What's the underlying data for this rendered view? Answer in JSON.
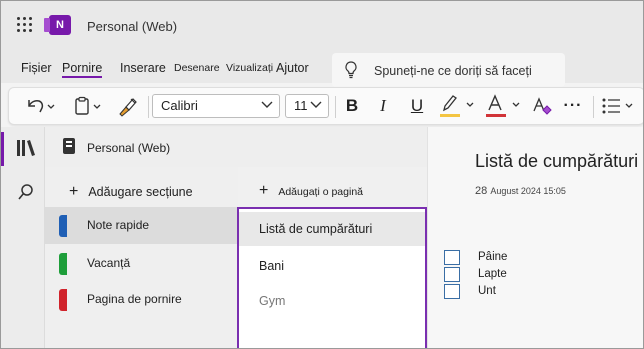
{
  "app": {
    "notebook_title": "Personal (Web)",
    "logo_letter": "N"
  },
  "menu": {
    "tabs": [
      "Fișier",
      "Pornire",
      "Inserare",
      "Desenare",
      "Vizualizați",
      "Ajutor"
    ],
    "active_tab": "Pornire",
    "tell_me": "Spuneți-ne ce doriți să faceți"
  },
  "ribbon": {
    "font_name": "Calibri",
    "font_size": "11",
    "bold": "B",
    "italic": "I",
    "underline": "U",
    "font_color_letter": "A",
    "highlight_color": "#f4c542",
    "font_color": "#d13438",
    "more": "···"
  },
  "notebook": {
    "header": "Personal (Web)",
    "add_section": "Adăugare secțiune",
    "add_page": "Adăugați o pagină",
    "sections": [
      {
        "label": "Note rapide",
        "color": "#1f5fb5"
      },
      {
        "label": "Vacanță",
        "color": "#1e9e3a"
      },
      {
        "label": "Pagina de pornire",
        "color": "#d0232b"
      }
    ],
    "selected_section": "Note rapide",
    "pages": [
      "Listă de cumpărături",
      "Bani",
      "Gym"
    ],
    "selected_page": "Listă de cumpărături"
  },
  "page": {
    "title": "Listă de cumpărături",
    "date_day": "28",
    "date_rest": "August 2024 15:05",
    "todos": [
      "Pâine",
      "Lapte",
      "Unt"
    ]
  },
  "colors": {
    "accent": "#7719aa"
  }
}
